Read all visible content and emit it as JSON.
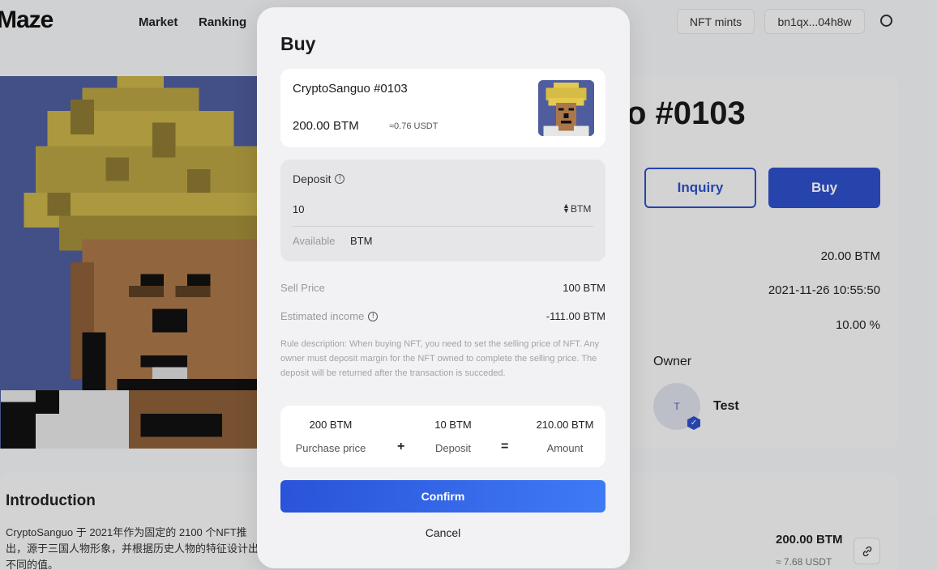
{
  "header": {
    "logo": "Maze",
    "nav": [
      "Market",
      "Ranking"
    ],
    "nft_mints_label": "NFT mints",
    "wallet_label": "bn1qx...04h8w",
    "globe_icon": "globe-icon"
  },
  "detail": {
    "title_partial": "o #0103",
    "inquiry_label": "Inquiry",
    "buy_label": "Buy",
    "value_1": "20.00 BTM",
    "value_2": "2021-11-26 10:55:50",
    "value_3": "10.00 %",
    "owner_label": "Owner",
    "owner_avatar_letter": "T",
    "owner_name": "Test"
  },
  "intro": {
    "title": "Introduction",
    "text": "CryptoSanguo 于 2021年作为固定的 2100 个NFT推出，源于三国人物形象，并根据历史人物的特征设计出不同的值。",
    "price": "200.00 BTM",
    "usdt": "≈ 7.68 USDT"
  },
  "modal": {
    "title": "Buy",
    "item": {
      "name": "CryptoSanguo #0103",
      "price": "200.00 BTM",
      "usdt": "≈0.76 USDT"
    },
    "deposit": {
      "label": "Deposit",
      "value": "10",
      "unit": "BTM",
      "available_label": "Available",
      "available_unit": "BTM"
    },
    "sell_price_label": "Sell Price",
    "sell_price_value": "100 BTM",
    "income_label": "Estimated income",
    "income_value": "-111.00 BTM",
    "rule": "Rule description: When buying NFT, you need to set the selling price of NFT. Any owner must deposit margin for the NFT owned to complete the selling price. The deposit will be returned after the transaction is succeded.",
    "summary": {
      "purchase_value": "200 BTM",
      "purchase_label": "Purchase price",
      "plus": "+",
      "deposit_value": "10 BTM",
      "deposit_label": "Deposit",
      "equals": "=",
      "amount_value": "210.00 BTM",
      "amount_label": "Amount"
    },
    "confirm_label": "Confirm",
    "cancel_label": "Cancel"
  },
  "colors": {
    "accent": "#2d50c9",
    "confirm_gradient_start": "#2a53d9",
    "confirm_gradient_end": "#3f7af5"
  }
}
